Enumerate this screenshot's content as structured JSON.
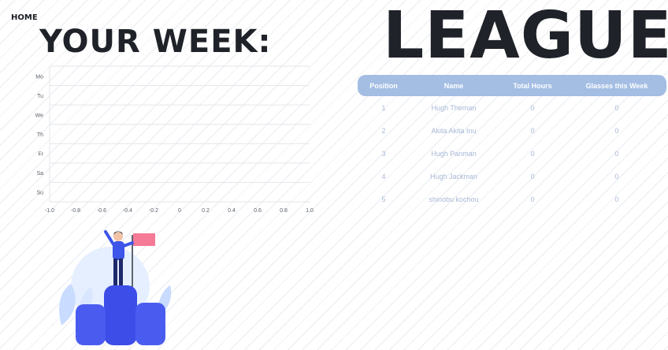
{
  "nav": {
    "home_label": "HOME"
  },
  "week": {
    "title": "YOUR WEEK:",
    "chart_data": {
      "type": "bar",
      "orientation": "horizontal",
      "categories": [
        "Mo",
        "Tu",
        "We",
        "Th",
        "Fr",
        "Sa",
        "Su"
      ],
      "values": [
        0,
        0,
        0,
        0,
        0,
        0,
        0
      ],
      "xlim": [
        -1.0,
        1.0
      ],
      "xticks": [
        "-1.0",
        "-0.8",
        "-0.6",
        "-0.4",
        "-0.2",
        "0",
        "0.2",
        "0.4",
        "0.6",
        "0.8",
        "1.0"
      ],
      "grid": true,
      "title": "",
      "xlabel": "",
      "ylabel": ""
    }
  },
  "league": {
    "title": "LEAGUE",
    "columns": [
      "Position",
      "Name",
      "Total Hours",
      "Glasses this Week"
    ],
    "rows": [
      [
        "1",
        "Hugh Theman",
        "0",
        "0"
      ],
      [
        "2",
        "Akita Akita Inu",
        "0",
        "0"
      ],
      [
        "3",
        "Hugh Panman",
        "0",
        "0"
      ],
      [
        "4",
        "Hugh Jackman",
        "0",
        "0"
      ],
      [
        "5",
        "shinobu kochou",
        "0",
        "0"
      ]
    ]
  },
  "colors": {
    "header_bg": "#a3bde3",
    "row_text": "#a8b9d6",
    "title_text": "#1f2228",
    "podium": "#3d4de8",
    "flag": "#f47a96"
  },
  "illustration": {
    "icon": "podium-winner-icon"
  }
}
